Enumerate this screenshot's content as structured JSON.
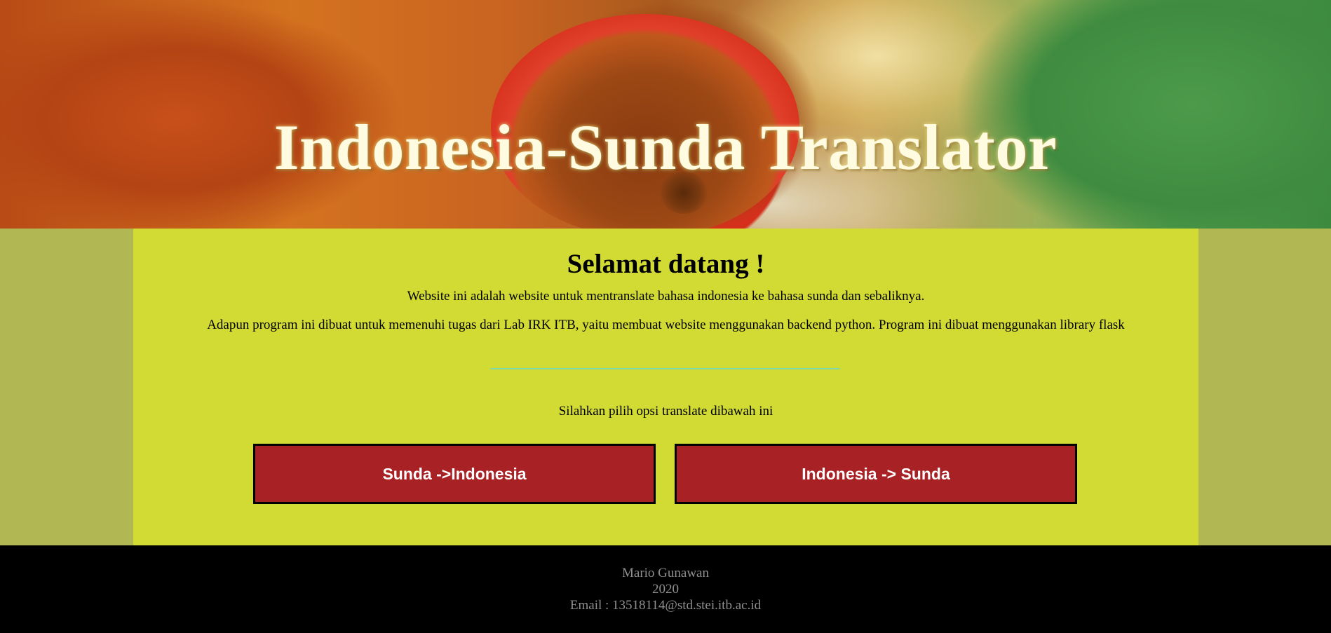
{
  "hero": {
    "title": "Indonesia-Sunda Translator"
  },
  "main": {
    "heading": "Selamat datang !",
    "intro_line_1": "Website ini adalah website untuk mentranslate bahasa indonesia ke bahasa sunda dan sebaliknya.",
    "intro_line_2": "Adapun program ini dibuat untuk memenuhi tugas dari Lab IRK ITB, yaitu membuat website menggunakan backend python. Program ini dibuat menggunakan library flask",
    "prompt": "Silahkan pilih opsi translate dibawah ini",
    "buttons": [
      {
        "label": "Sunda ->Indonesia"
      },
      {
        "label": "Indonesia -> Sunda"
      }
    ]
  },
  "footer": {
    "name": "Mario Gunawan",
    "year": "2020",
    "email": "Email : 13518114@std.stei.itb.ac.id"
  },
  "colors": {
    "content_background": "#d2da34",
    "side_background": "#b1b752",
    "button_background": "#a82125",
    "footer_background": "#000000",
    "footer_text": "#8f8f8f",
    "divider": "#7fd9a8"
  }
}
